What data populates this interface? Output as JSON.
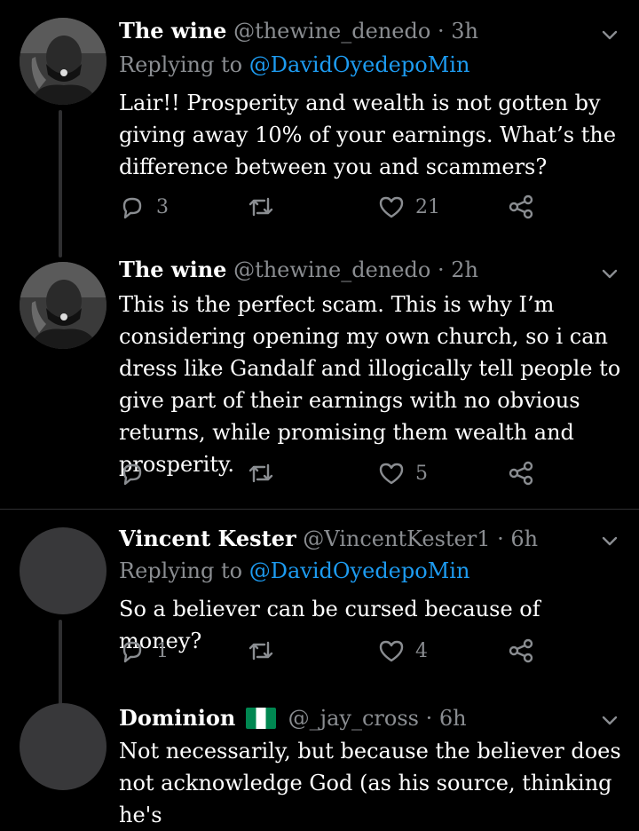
{
  "tweets": [
    {
      "name": "The wine",
      "handle": "@thewine_denedo",
      "time": "3h",
      "reply_prefix": "Replying to",
      "reply_mention": "@DavidOyedepoMin",
      "body": "Lair!! Prosperity and wealth is not gotten by giving away 10% of your earnings. What’s the difference between you and scammers?",
      "reply_count": "3",
      "retweet_count": "",
      "like_count": "21"
    },
    {
      "name": "The wine",
      "handle": "@thewine_denedo",
      "time": "2h",
      "body": "This is the perfect scam. This is why I’m considering opening my own church, so i can dress like Gandalf and illogically tell people to give part of their earnings with no obvious returns, while promising them wealth and prosperity.",
      "reply_count": "",
      "retweet_count": "",
      "like_count": "5"
    },
    {
      "name": "Vincent Kester",
      "handle": "@VincentKester1",
      "time": "6h",
      "reply_prefix": "Replying to",
      "reply_mention": "@DavidOyedepoMin",
      "body": "So a believer can be cursed because of money?",
      "reply_count": "1",
      "retweet_count": "",
      "like_count": "4"
    },
    {
      "name": "Dominion",
      "handle": "@_jay_cross",
      "time": "6h",
      "flag_icon": "nigeria-flag-icon",
      "body": "Not necessarily, but because the believer does not acknowledge God (as his source, thinking he's"
    }
  ],
  "separator": "·",
  "icons": [
    "reply-icon",
    "retweet-icon",
    "like-icon",
    "share-icon",
    "chevron-down-icon"
  ],
  "colors": {
    "background": "#000000",
    "muted": "#8a8d91",
    "mention": "#1d9bf0",
    "divider": "#2f2f31"
  }
}
